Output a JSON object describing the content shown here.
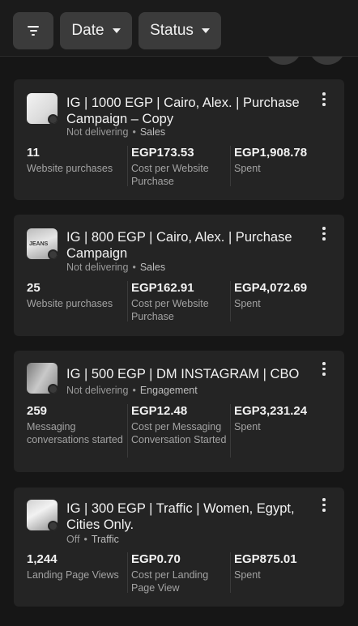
{
  "filters": {
    "date_label": "Date",
    "status_label": "Status"
  },
  "campaigns": [
    {
      "name": "IG | 1000 EGP | Cairo, Alex. | Purchase Campaign – Copy",
      "delivery": "Not delivering",
      "objective": "Sales",
      "result_value": "11",
      "result_label": "Website purchases",
      "cost_value": "EGP173.53",
      "cost_label": "Cost per Website Purchase",
      "spent_value": "EGP1,908.78",
      "spent_label": "Spent"
    },
    {
      "name": "IG | 800 EGP | Cairo, Alex. | Purchase Campaign",
      "delivery": "Not delivering",
      "objective": "Sales",
      "result_value": "25",
      "result_label": "Website purchases",
      "cost_value": "EGP162.91",
      "cost_label": "Cost per Website Purchase",
      "spent_value": "EGP4,072.69",
      "spent_label": "Spent",
      "thumb_text": "JEANS"
    },
    {
      "name": "IG | 500 EGP | DM INSTAGRAM | CBO",
      "delivery": "Not delivering",
      "objective": "Engagement",
      "result_value": "259",
      "result_label": "Messaging conversations started",
      "cost_value": "EGP12.48",
      "cost_label": "Cost per Messaging Conversation Started",
      "spent_value": "EGP3,231.24",
      "spent_label": "Spent"
    },
    {
      "name": "IG | 300 EGP | Traffic | Women, Egypt, Cities Only.",
      "delivery": "Off",
      "objective": "Traffic",
      "result_value": "1,244",
      "result_label": "Landing Page Views",
      "cost_value": "EGP0.70",
      "cost_label": "Cost per Landing Page View",
      "spent_value": "EGP875.01",
      "spent_label": "Spent"
    }
  ]
}
